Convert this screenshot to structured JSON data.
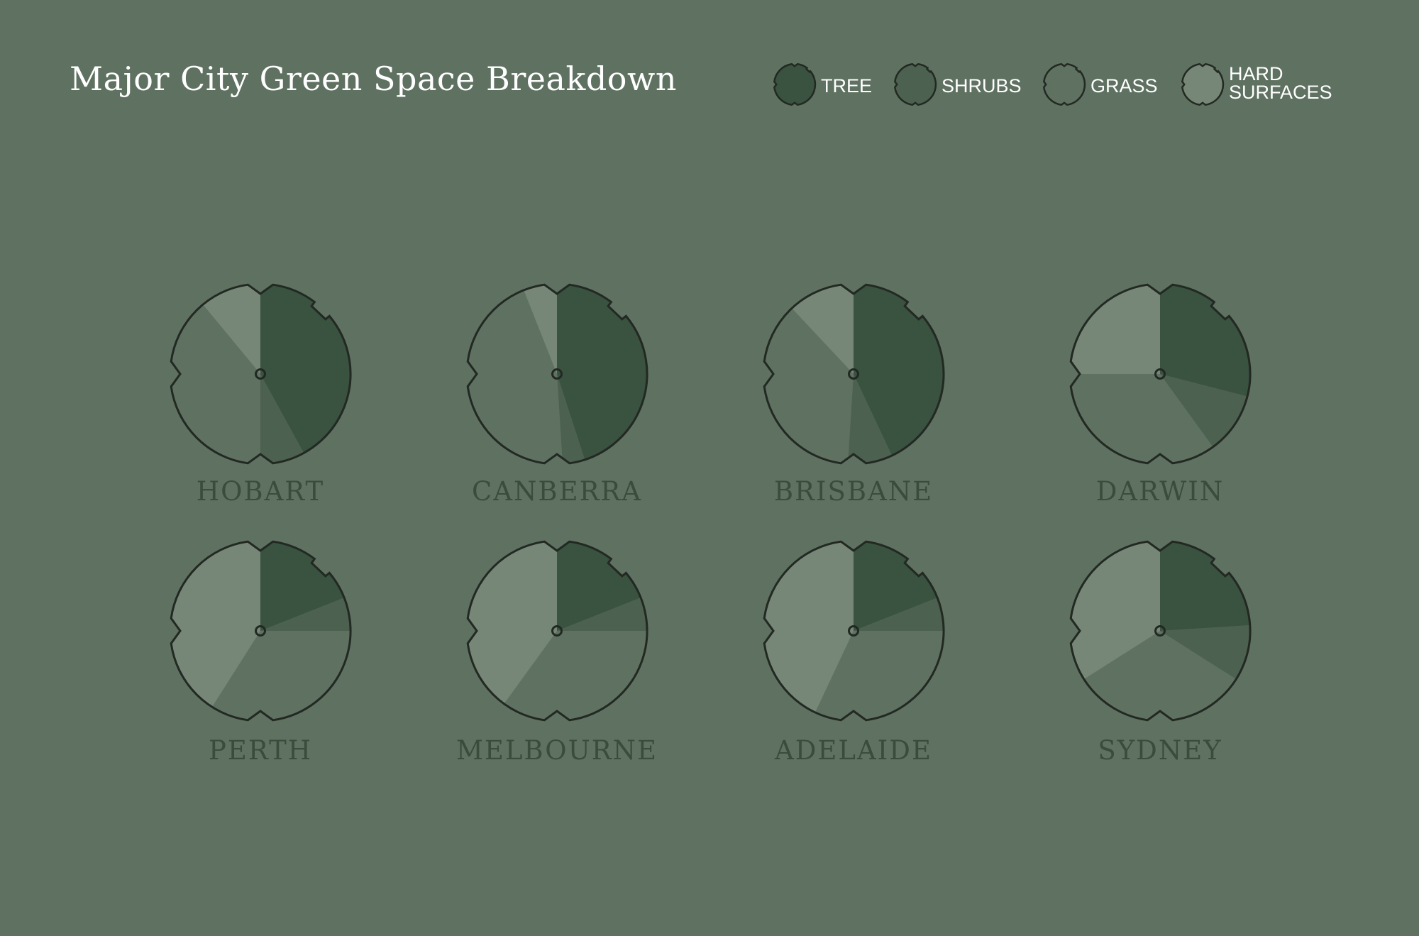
{
  "title": "Major City Green Space Breakdown",
  "colors": {
    "background": "#5f7161",
    "tree": "#3a5240",
    "shrubs": "#4d6150",
    "grass": "#5f7161",
    "hard_surfaces": "#768777",
    "outline": "#222922",
    "city_label": "#3a4d3d"
  },
  "legend": [
    {
      "key": "tree",
      "label": "TREE"
    },
    {
      "key": "shrubs",
      "label": "SHRUBS"
    },
    {
      "key": "grass",
      "label": "GRASS"
    },
    {
      "key": "hard_surfaces",
      "label": "HARD SURFACES",
      "lines": [
        "HARD",
        "SURFACES"
      ]
    }
  ],
  "chart_data": {
    "type": "pie",
    "title": "Major City Green Space Breakdown",
    "categories": [
      "TREE",
      "SHRUBS",
      "GRASS",
      "HARD SURFACES"
    ],
    "series": [
      {
        "name": "HOBART",
        "values": [
          42,
          8,
          39,
          11
        ]
      },
      {
        "name": "CANBERRA",
        "values": [
          45,
          4,
          45,
          6
        ]
      },
      {
        "name": "BRISBANE",
        "values": [
          43,
          8,
          37,
          12
        ]
      },
      {
        "name": "DARWIN",
        "values": [
          29,
          11,
          35,
          25
        ]
      },
      {
        "name": "PERTH",
        "values": [
          19,
          6,
          34,
          41
        ]
      },
      {
        "name": "MELBOURNE",
        "values": [
          19,
          6,
          35,
          40
        ]
      },
      {
        "name": "ADELAIDE",
        "values": [
          19,
          6,
          32,
          43
        ]
      },
      {
        "name": "SYDNEY",
        "values": [
          24,
          10,
          32,
          34
        ]
      }
    ]
  }
}
